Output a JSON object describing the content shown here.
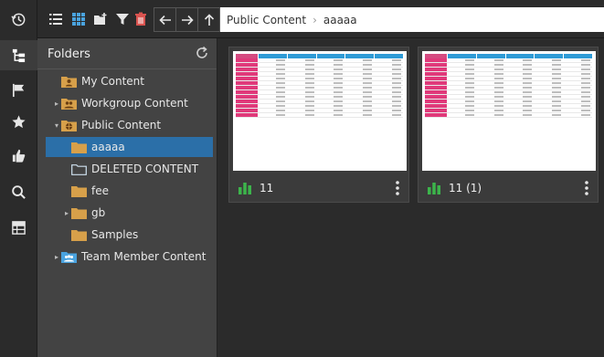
{
  "toolbar": {
    "breadcrumb": [
      "Public Content",
      "aaaaa"
    ]
  },
  "folders": {
    "title": "Folders",
    "items": [
      {
        "label": "My Content"
      },
      {
        "label": "Workgroup Content"
      },
      {
        "label": "Public Content"
      },
      {
        "label": "aaaaa"
      },
      {
        "label": "DELETED CONTENT"
      },
      {
        "label": "fee"
      },
      {
        "label": "gb"
      },
      {
        "label": "Samples"
      },
      {
        "label": "Team Member Content"
      }
    ]
  },
  "content": {
    "cards": [
      {
        "label": "11"
      },
      {
        "label": "11 (1)"
      }
    ]
  },
  "colors": {
    "selected": "#2b6fa8",
    "folder": "#d7a04a",
    "chart": "#3cb44b",
    "accent_pink": "#e0397a",
    "accent_blue": "#2e9bd6"
  }
}
